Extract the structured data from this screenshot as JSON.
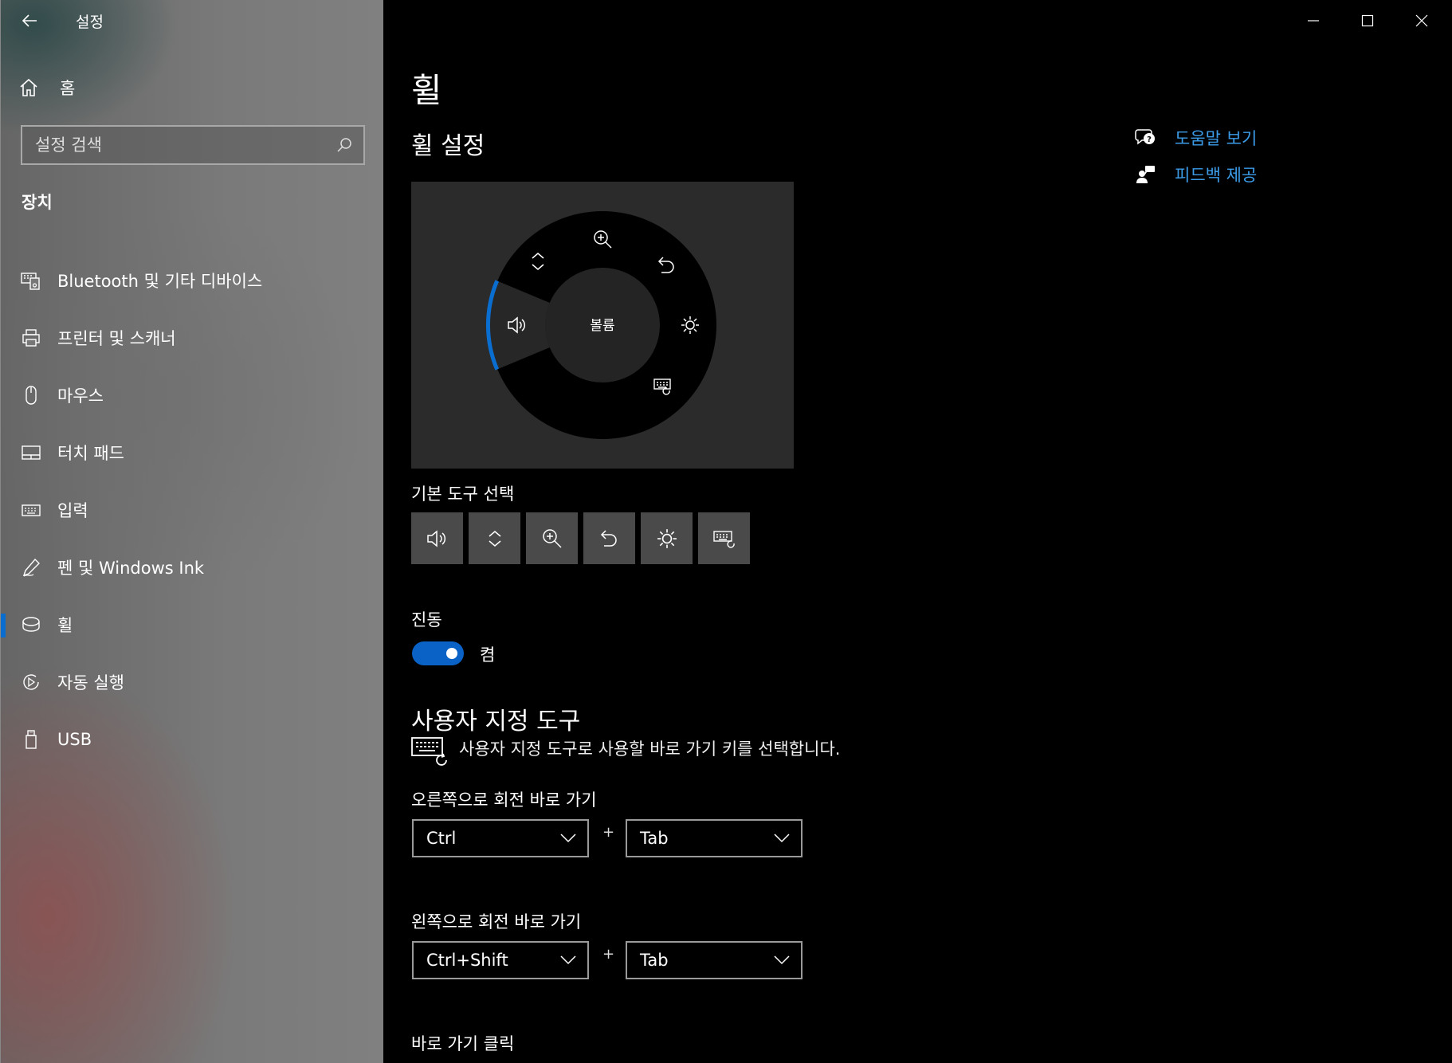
{
  "app": {
    "title": "설정"
  },
  "sidebar": {
    "home_label": "홈",
    "search_placeholder": "설정 검색",
    "section_title": "장치",
    "items": [
      {
        "label": "Bluetooth 및 기타 디바이스",
        "icon": "bluetooth-devices-icon"
      },
      {
        "label": "프린터 및 스캐너",
        "icon": "printer-icon"
      },
      {
        "label": "마우스",
        "icon": "mouse-icon"
      },
      {
        "label": "터치 패드",
        "icon": "touchpad-icon"
      },
      {
        "label": "입력",
        "icon": "keyboard-icon"
      },
      {
        "label": "펜 및 Windows Ink",
        "icon": "pen-icon"
      },
      {
        "label": "휠",
        "icon": "wheel-icon",
        "active": true
      },
      {
        "label": "자동 실행",
        "icon": "autoplay-icon"
      },
      {
        "label": "USB",
        "icon": "usb-icon"
      }
    ]
  },
  "main": {
    "page_title": "휠",
    "sub_title": "휠 설정",
    "wheel_center_label": "볼륨",
    "default_tool_label": "기본 도구 선택",
    "default_tools": [
      "volume-icon",
      "scroll-icon",
      "zoom-icon",
      "undo-icon",
      "brightness-icon",
      "custom-keyboard-icon"
    ],
    "vibration_label": "진동",
    "vibration_state": "켬",
    "custom_tool_title": "사용자 지정 도구",
    "custom_tool_desc": "사용자 지정 도구로 사용할 바로 가기 키를 선택합니다.",
    "rotate_right": {
      "label": "오른쪽으로 회전 바로 가기",
      "modifier": "Ctrl",
      "key": "Tab"
    },
    "rotate_left": {
      "label": "왼쪽으로 회전 바로 가기",
      "modifier": "Ctrl+Shift",
      "key": "Tab"
    },
    "plus_sign": "+",
    "shortcut_click_label": "바로 가기 클릭"
  },
  "help": {
    "help_label": "도움말 보기",
    "feedback_label": "피드백 제공"
  },
  "colors": {
    "accent": "#0a6ed1",
    "link": "#3c9ce8"
  }
}
